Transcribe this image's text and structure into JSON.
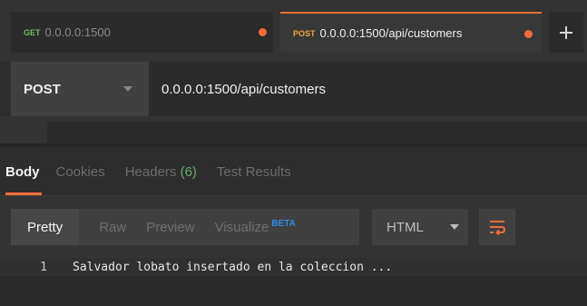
{
  "tabs": [
    {
      "method": "GET",
      "url": "0.0.0.0:1500",
      "unsaved": true,
      "active": false
    },
    {
      "method": "POST",
      "url": "0.0.0.0:1500/api/customers",
      "unsaved": true,
      "active": true
    }
  ],
  "request": {
    "method": "POST",
    "url": "0.0.0.0:1500/api/customers"
  },
  "response": {
    "tabs": {
      "body": "Body",
      "cookies": "Cookies",
      "headers": "Headers",
      "headers_count": "(6)",
      "test_results": "Test Results"
    },
    "format": {
      "pretty": "Pretty",
      "raw": "Raw",
      "preview": "Preview",
      "visualize": "Visualize",
      "beta": "BETA",
      "language": "HTML"
    },
    "lines": [
      {
        "number": "1",
        "text": "Salvador lobato insertado en la coleccion ..."
      }
    ]
  },
  "colors": {
    "accent": "#f26b3a",
    "get": "#6bbf59",
    "post": "#f2a73a",
    "beta": "#2f8be6"
  },
  "icons": {
    "new_tab": "plus-icon",
    "method_caret": "chevron-down-icon",
    "language_caret": "chevron-down-icon",
    "wrap": "wrap-lines-icon",
    "unsaved": "unsaved-dot-icon"
  }
}
